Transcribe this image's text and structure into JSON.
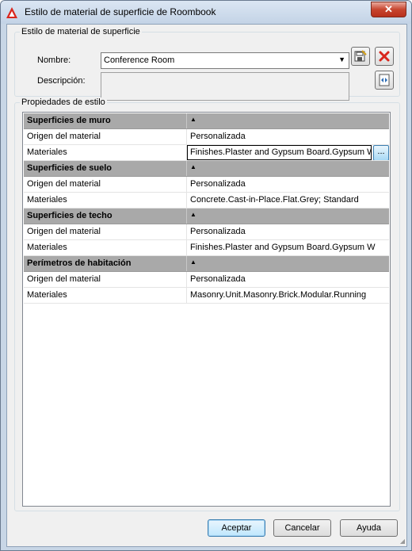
{
  "window": {
    "title": "Estilo de material de superficie de Roombook",
    "close_label": "✕"
  },
  "surface_group": {
    "legend": "Estilo de material de superficie",
    "name_label": "Nombre:",
    "name_value": "Conference Room",
    "description_label": "Descripción:",
    "description_value": ""
  },
  "properties": {
    "legend": "Propiedades de estilo",
    "categories": [
      {
        "title": "Superficies de muro",
        "rows": [
          {
            "label": "Origen del material",
            "value": "Personalizada"
          },
          {
            "label": "Materiales",
            "value": "Finishes.Plaster and Gypsum Board.Gypsum Wallboard"
          }
        ]
      },
      {
        "title": "Superficies de suelo",
        "rows": [
          {
            "label": "Origen del material",
            "value": "Personalizada"
          },
          {
            "label": "Materiales",
            "value": "Concrete.Cast-in-Place.Flat.Grey; Standard"
          }
        ]
      },
      {
        "title": "Superficies de techo",
        "rows": [
          {
            "label": "Origen del material",
            "value": "Personalizada"
          },
          {
            "label": "Materiales",
            "value": "Finishes.Plaster and Gypsum Board.Gypsum W"
          }
        ]
      },
      {
        "title": "Perímetros de habitación",
        "rows": [
          {
            "label": "Origen del material",
            "value": "Personalizada"
          },
          {
            "label": "Materiales",
            "value": "Masonry.Unit.Masonry.Brick.Modular.Running"
          }
        ]
      }
    ],
    "edit_button_label": "..."
  },
  "buttons": {
    "accept": "Aceptar",
    "cancel": "Cancelar",
    "help": "Ayuda"
  },
  "icons": {
    "app": "autocad-icon",
    "save": "save-style-icon",
    "delete": "delete-icon",
    "swap": "swap-icon"
  },
  "colors": {
    "category_bg": "#a9a9a9",
    "accent": "#3c7fb1",
    "delete_red": "#d9261c"
  }
}
